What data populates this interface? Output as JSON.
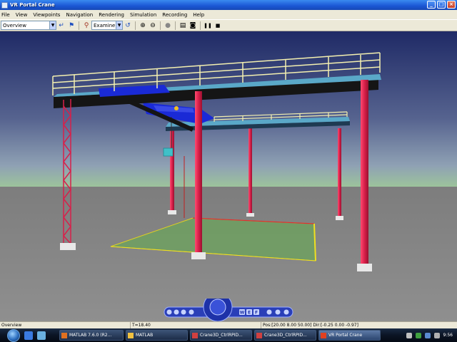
{
  "window": {
    "title": "VR Portal Crane",
    "minimize": "_",
    "maximize": "□",
    "close": "×"
  },
  "menu": {
    "items": [
      "File",
      "View",
      "Viewpoints",
      "Navigation",
      "Rendering",
      "Simulation",
      "Recording",
      "Help"
    ]
  },
  "toolbar": {
    "viewpoint_value": "Overview",
    "nav_mode_value": "Examine",
    "pause_glyph": "❚❚",
    "stop_glyph": "■"
  },
  "navpanel": {
    "letters": [
      "W",
      "E",
      "F"
    ]
  },
  "statusbar": {
    "viewpoint": "Overview",
    "time": "T=18.40",
    "position": "Pos:[20.00 8.00 50.00] Dir:[-0.25 0.00 -0.97]"
  },
  "taskbar": {
    "tasks": [
      {
        "label": "MATLAB 7.6.0 (R2...",
        "icon_color": "#e07020",
        "active": false
      },
      {
        "label": "MATLAB",
        "icon_color": "#f0c040",
        "active": false
      },
      {
        "label": "Crane3D_CtrlRPID...",
        "icon_color": "#d04040",
        "active": false
      },
      {
        "label": "Crane3D_CtrlRPID...",
        "icon_color": "#d04040",
        "active": false
      },
      {
        "label": "VR Portal Crane",
        "icon_color": "#e04020",
        "active": true
      }
    ],
    "clock": "9:56"
  },
  "colors": {
    "sky_top": "#1f2a66",
    "sky_mid": "#6f83a6",
    "horizon": "#9ec898",
    "ground": "#8a8a8a",
    "column": "#d8204a",
    "beam": "#1a1a1a",
    "trolley": "#1a2ad6",
    "floor_zone": "#6fa060",
    "railing": "#f4f0b0"
  }
}
